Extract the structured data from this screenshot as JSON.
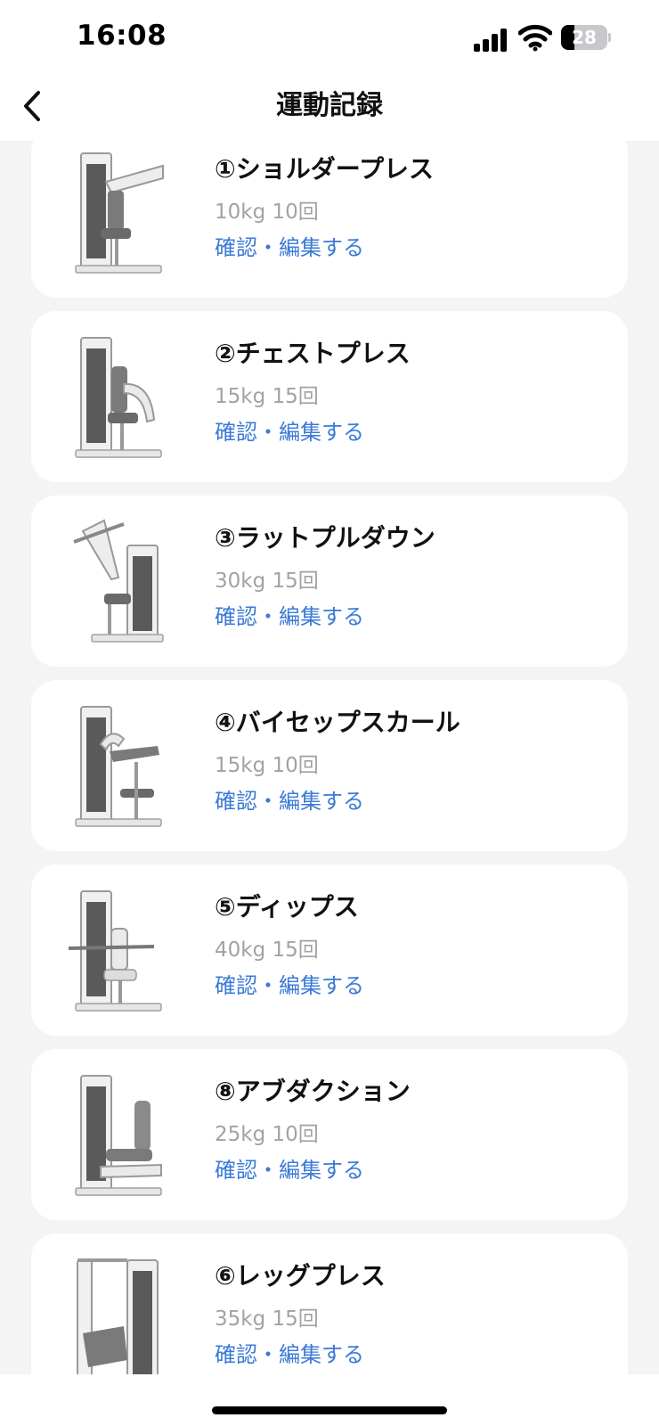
{
  "status_bar": {
    "time": "16:08",
    "battery_level": "28",
    "battery_fraction": 0.28,
    "icons": [
      "signal-icon",
      "wifi-icon",
      "battery-icon"
    ]
  },
  "nav": {
    "title": "運動記録",
    "back_icon": "chevron-left-icon"
  },
  "link_color": "#3b7ad6",
  "records": [
    {
      "title": "①ショルダープレス",
      "detail": "10kg 10回",
      "link": "確認・編集する",
      "machine": "shoulder-press-machine"
    },
    {
      "title": "②チェストプレス",
      "detail": "15kg 15回",
      "link": "確認・編集する",
      "machine": "chest-press-machine"
    },
    {
      "title": "③ラットプルダウン",
      "detail": "30kg 15回",
      "link": "確認・編集する",
      "machine": "lat-pulldown-machine"
    },
    {
      "title": "④バイセップスカール",
      "detail": "15kg 10回",
      "link": "確認・編集する",
      "machine": "biceps-curl-machine"
    },
    {
      "title": "⑤ディップス",
      "detail": "40kg 15回",
      "link": "確認・編集する",
      "machine": "dips-machine"
    },
    {
      "title": "⑧アブダクション",
      "detail": "25kg 10回",
      "link": "確認・編集する",
      "machine": "abduction-machine"
    },
    {
      "title": "⑥レッグプレス",
      "detail": "35kg 15回",
      "link": "確認・編集する",
      "machine": "leg-press-machine"
    }
  ]
}
